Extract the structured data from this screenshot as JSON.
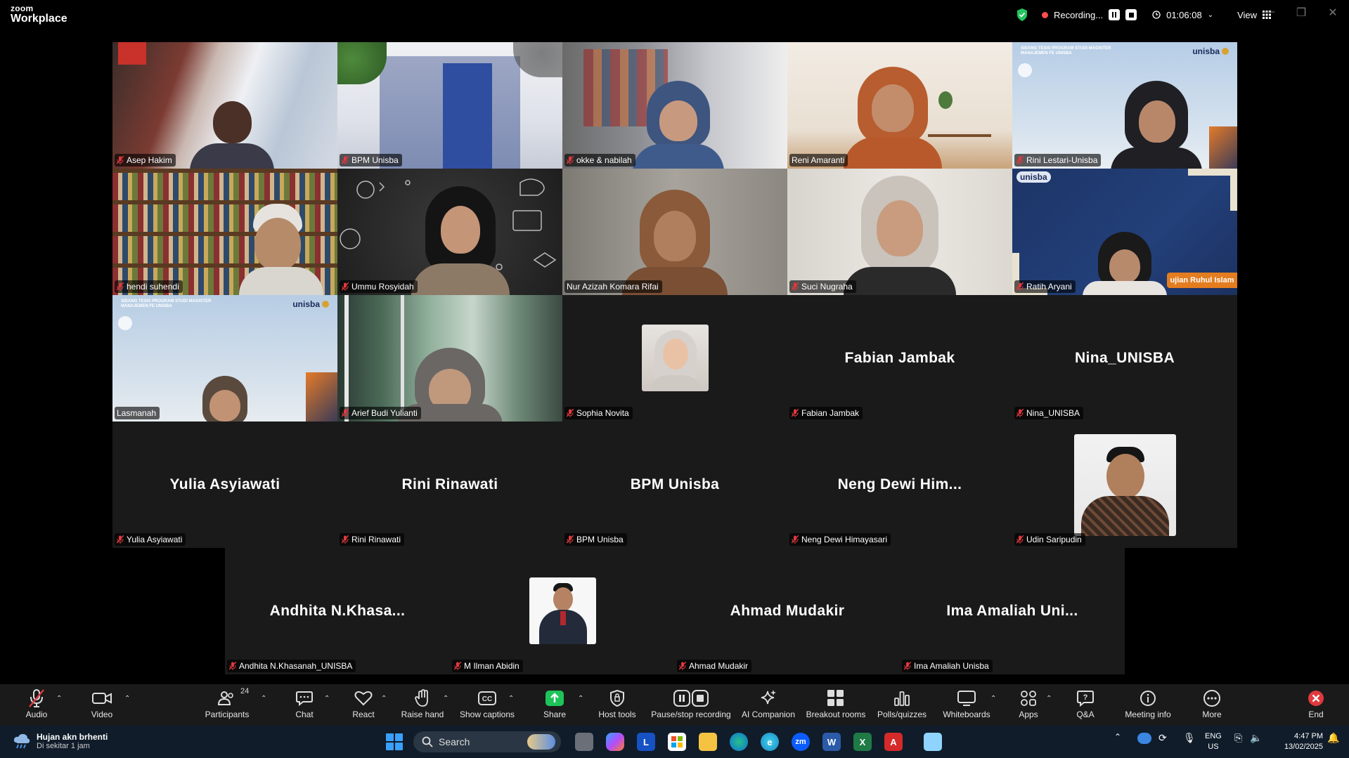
{
  "app": {
    "logo_line1": "zoom",
    "logo_line2": "Workplace"
  },
  "topbar": {
    "recording_label": "Recording...",
    "timer": "01:06:08",
    "view_label": "View"
  },
  "participants_grid": [
    {
      "name": "Asep Hakim",
      "muted": true,
      "video": true
    },
    {
      "name": "BPM Unisba",
      "muted": true,
      "video": true
    },
    {
      "name": "okke & nabilah",
      "muted": true,
      "video": true
    },
    {
      "name": "Reni Amaranti",
      "muted": false,
      "video": true,
      "active_speaker": true
    },
    {
      "name": "Rini Lestari-Unisba",
      "muted": true,
      "video": true
    },
    {
      "name": "hendi suhendi",
      "muted": true,
      "video": true
    },
    {
      "name": "Ummu Rosyidah",
      "muted": true,
      "video": true
    },
    {
      "name": "Nur Azizah Komara Rifai",
      "muted": false,
      "video": true
    },
    {
      "name": "Suci Nugraha",
      "muted": true,
      "video": true
    },
    {
      "name": "Ratih Aryani",
      "muted": true,
      "video": true
    },
    {
      "name": "Lasmanah",
      "muted": false,
      "video": true
    },
    {
      "name": "Arief Budi Yulianti",
      "muted": true,
      "video": true
    },
    {
      "name": "Sophia Novita",
      "muted": true,
      "video": false,
      "has_photo": true
    },
    {
      "name": "Fabian Jambak",
      "display": "Fabian Jambak",
      "muted": true,
      "video": false
    },
    {
      "name": "Nina_UNISBA",
      "display": "Nina_UNISBA",
      "muted": true,
      "video": false
    },
    {
      "name": "Yulia Asyiawati",
      "display": "Yulia Asyiawati",
      "muted": true,
      "video": false
    },
    {
      "name": "Rini Rinawati",
      "display": "Rini Rinawati",
      "muted": true,
      "video": false
    },
    {
      "name": "BPM Unisba",
      "display": "BPM Unisba",
      "muted": true,
      "video": false
    },
    {
      "name": "Neng Dewi Himayasari",
      "display": "Neng Dewi Him...",
      "muted": true,
      "video": false
    },
    {
      "name": "Udin Saripudin",
      "muted": true,
      "video": false,
      "has_photo": true
    },
    {
      "name": "Andhita N.Khasanah_UNISBA",
      "display": "Andhita N.Khasa...",
      "muted": true,
      "video": false
    },
    {
      "name": "M Ilman Abidin",
      "muted": true,
      "video": false,
      "has_photo": true
    },
    {
      "name": "Ahmad Mudakir",
      "display": "Ahmad Mudakir",
      "muted": true,
      "video": false
    },
    {
      "name": "Ima Amaliah Unisba",
      "display": "Ima Amaliah Uni...",
      "muted": true,
      "video": false
    }
  ],
  "backgrounds": {
    "unisba_logo": "unisba",
    "sidang_text": "SIDANG TESIS PROGRAM STUDI MAGISTER MANAJEMEN FE UNISBA",
    "banner_text": "ujian Ruhul Islam"
  },
  "toolbar": {
    "audio": "Audio",
    "video": "Video",
    "participants": "Participants",
    "participants_count": "24",
    "chat": "Chat",
    "react": "React",
    "raise_hand": "Raise hand",
    "captions": "Show captions",
    "share": "Share",
    "host_tools": "Host tools",
    "recording": "Pause/stop recording",
    "ai": "AI Companion",
    "breakout": "Breakout rooms",
    "polls": "Polls/quizzes",
    "whiteboards": "Whiteboards",
    "apps": "Apps",
    "qa": "Q&A",
    "meeting_info": "Meeting info",
    "more": "More",
    "end": "End"
  },
  "taskbar": {
    "weather_title": "Hujan akn brhenti",
    "weather_sub": "Di sekitar 1 jam",
    "search_placeholder": "Search",
    "lang1": "ENG",
    "lang2": "US",
    "time": "4:47 PM",
    "date": "13/02/2025"
  },
  "colors": {
    "active_speaker": "#23d96b",
    "muted": "#e0393e",
    "share": "#1ec45a",
    "end": "#e0393e"
  }
}
